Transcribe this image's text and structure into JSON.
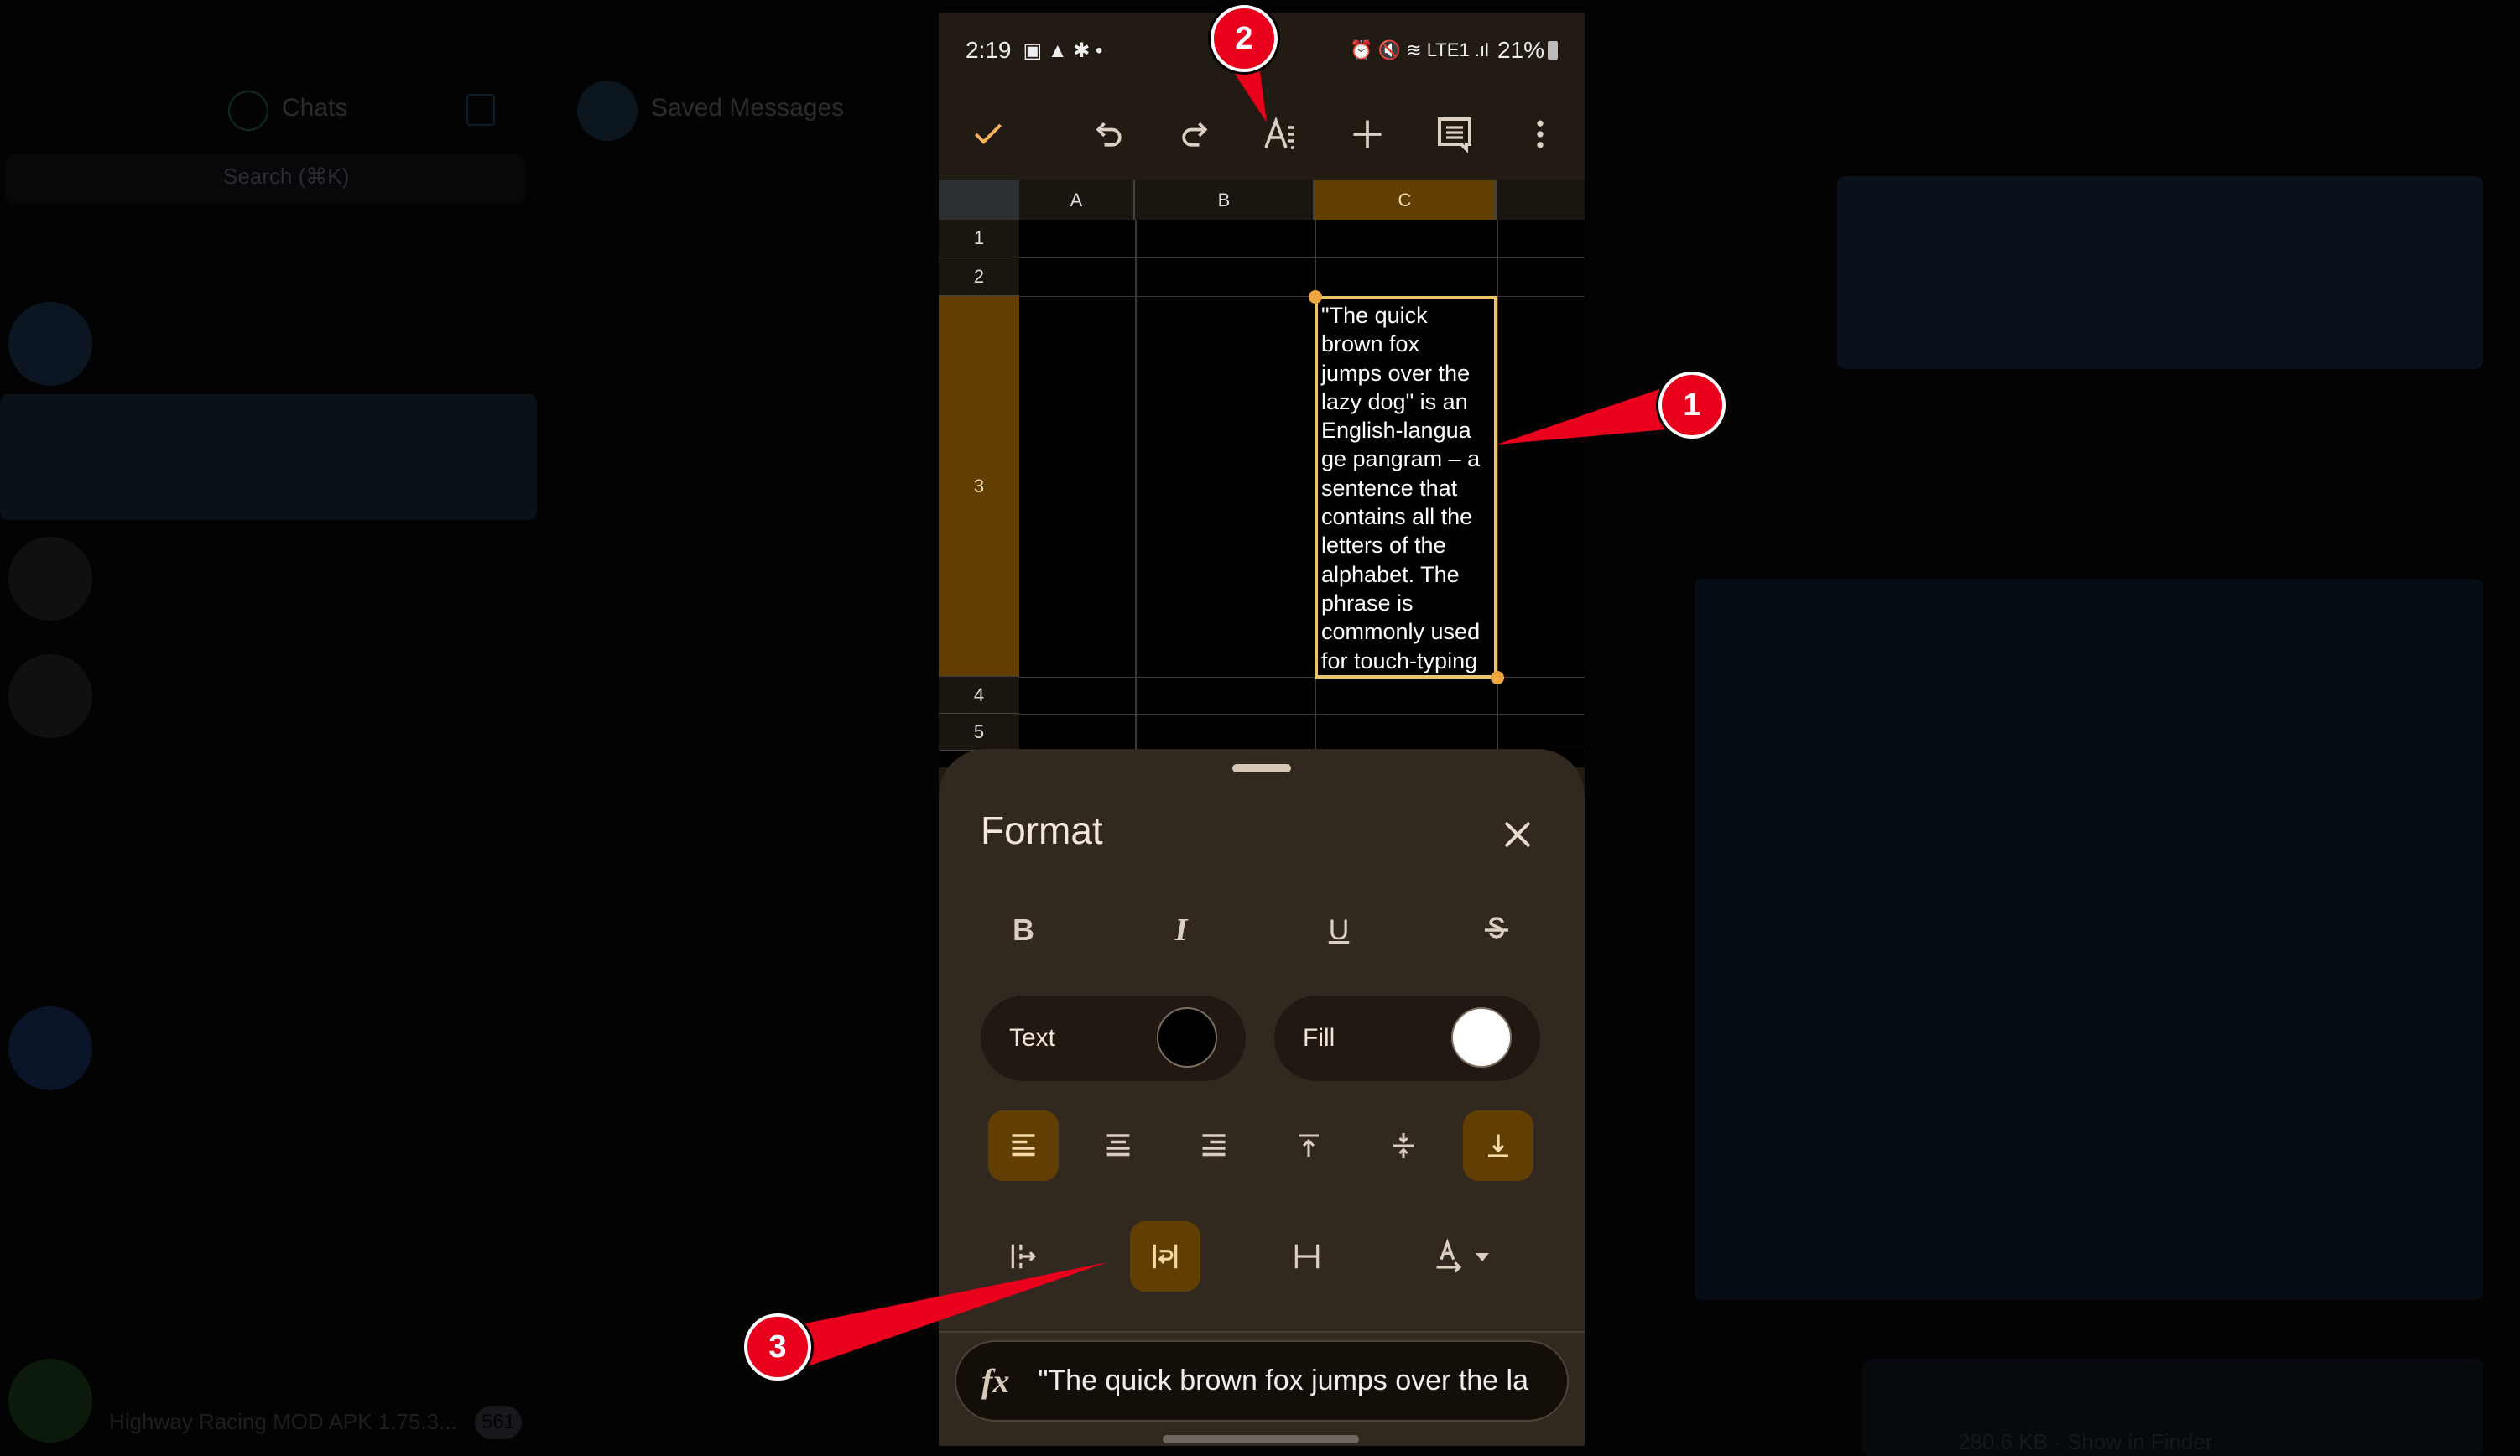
{
  "background": {
    "chats_title": "Chats",
    "saved_messages": "Saved Messages",
    "search_placeholder": "Search (⌘K)",
    "last_chat_preview": "Highway Racing MOD APK 1.75.3...",
    "last_chat_badge": "561",
    "file_info": "280.6 KB - Show in Finder"
  },
  "status_bar": {
    "time": "2:19",
    "battery": "21%",
    "network": "LTE1"
  },
  "toolbar": {
    "icons": [
      "check-icon",
      "undo-icon",
      "redo-icon",
      "format-text-icon",
      "add-icon",
      "comment-icon",
      "more-vert-icon"
    ]
  },
  "sheet": {
    "columns": [
      "A",
      "B",
      "C"
    ],
    "rows": [
      "1",
      "2",
      "3",
      "4",
      "5"
    ],
    "selected_cell": "C3",
    "cell_c3": "\"The quick brown fox jumps over the lazy dog\" is an English-language pangram – a sentence that contains all the letters of the alphabet. The phrase is commonly used for touch-typing",
    "cell_c3_lines": [
      "\"The quick",
      "brown fox",
      "jumps over the",
      "lazy dog\" is an",
      "English-langua",
      "ge pangram – a",
      "sentence that",
      "contains all the",
      "letters of the",
      "alphabet. The",
      "phrase is",
      "commonly used",
      "for touch-typing"
    ]
  },
  "format_panel": {
    "title": "Format",
    "text_label": "Text",
    "fill_label": "Fill",
    "text_color": "#000000",
    "fill_color": "#ffffff",
    "bold": "B",
    "italic": "I",
    "underline": "U",
    "horizontal_align": "left",
    "vertical_align": "bottom",
    "wrap": "wrap",
    "accent_color": "#613e02"
  },
  "formula_bar": {
    "value": "\"The quick brown fox jumps over the la"
  },
  "annotations": [
    "1",
    "2",
    "3"
  ]
}
